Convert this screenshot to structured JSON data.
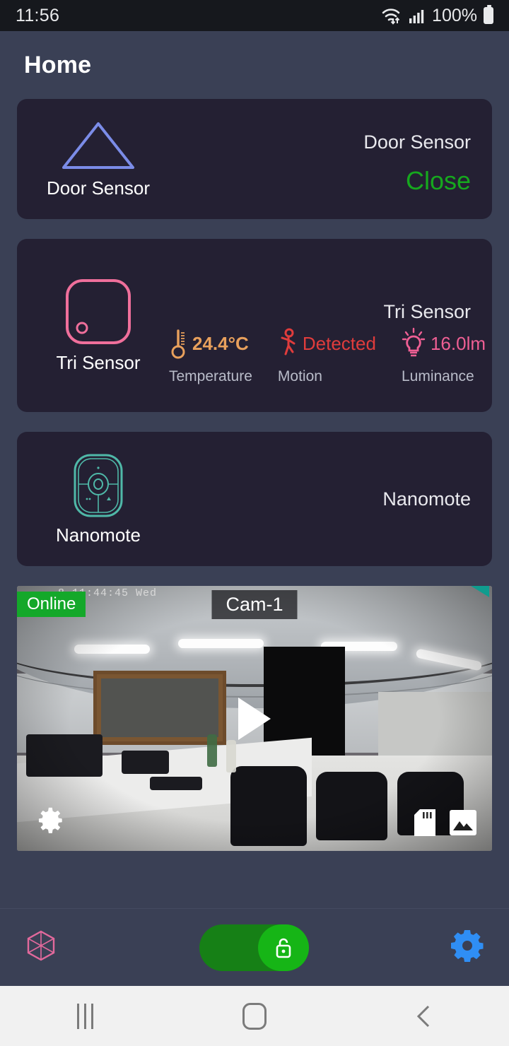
{
  "status_bar": {
    "time": "11:56",
    "battery_pct": "100%",
    "wifi_icon": "wifi-icon",
    "signal_icon": "signal-bars-icon",
    "battery_icon": "battery-full-icon"
  },
  "header": {
    "title": "Home"
  },
  "colors": {
    "page_bg": "#3a4055",
    "card_bg": "#242033",
    "door_icon": "#7b8ce8",
    "state_green": "#16a81e",
    "tri_icon": "#ef6f9b",
    "temp": "#e8a05c",
    "motion": "#e03c3c",
    "lumin": "#ef5f94",
    "nano_icon": "#4fb8a8",
    "online_badge": "#14a82a",
    "toggle_on": "#168016",
    "gear_blue": "#2f8ef4",
    "cube_pink": "#e2699c"
  },
  "devices": [
    {
      "icon": "door-sensor-triangle-icon",
      "name": "Door Sensor",
      "title": "Door Sensor",
      "state": "Close"
    },
    {
      "icon": "tri-sensor-icon",
      "name": "Tri Sensor",
      "title": "Tri Sensor",
      "metrics": [
        {
          "icon": "thermometer-icon",
          "value": "24.4°C",
          "label": "Temperature"
        },
        {
          "icon": "motion-person-icon",
          "value": "Detected",
          "label": "Motion"
        },
        {
          "icon": "light-bulb-icon",
          "value": "16.0lm",
          "label": "Luminance"
        }
      ]
    },
    {
      "icon": "nanomote-remote-icon",
      "name": "Nanomote",
      "title": "Nanomote"
    }
  ],
  "camera": {
    "status_badge": "Online",
    "label": "Cam-1",
    "timestamp_overlay": "8 11:44:45 Wed",
    "play_icon": "play-icon",
    "settings_icon": "gear-icon",
    "sdcard_icon": "sd-card-icon",
    "gallery_icon": "gallery-image-icon"
  },
  "bottom_bar": {
    "left_icon": "cube-icon",
    "toggle_icon": "unlock-padlock-icon",
    "toggle_state": "on",
    "right_icon": "gear-icon"
  },
  "nav_bar": {
    "recents_icon": "recents-icon",
    "home_icon": "home-icon",
    "back_icon": "back-icon"
  }
}
